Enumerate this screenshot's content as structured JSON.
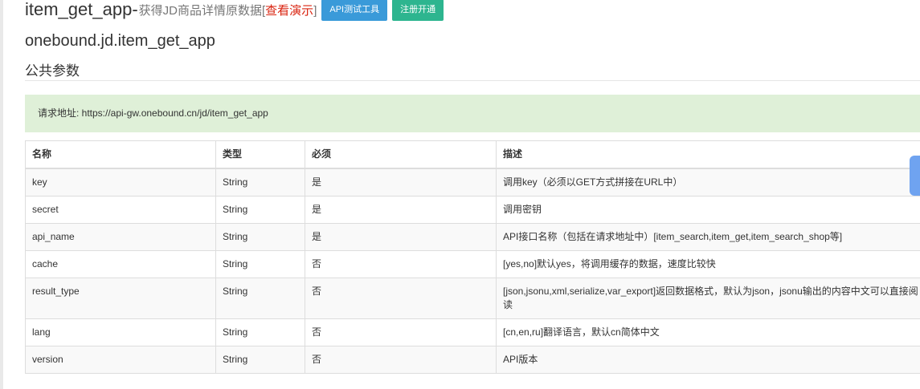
{
  "header": {
    "title": "item_get_app-",
    "subtitle": "获得JD商品详情原数据",
    "demo_open": "[",
    "demo_label": "查看演示",
    "demo_close": "]",
    "btn_api_test": "API测试工具",
    "btn_register": "注册开通"
  },
  "api_name": "onebound.jd.item_get_app",
  "section_title": "公共参数",
  "request_url": "请求地址: https://api-gw.onebound.cn/jd/item_get_app",
  "params_table": {
    "headers": [
      "名称",
      "类型",
      "必须",
      "描述"
    ],
    "rows": [
      {
        "name": "key",
        "type": "String",
        "required": "是",
        "desc": "调用key（必须以GET方式拼接在URL中）"
      },
      {
        "name": "secret",
        "type": "String",
        "required": "是",
        "desc": "调用密钥"
      },
      {
        "name": "api_name",
        "type": "String",
        "required": "是",
        "desc": "API接口名称（包括在请求地址中）[item_search,item_get,item_search_shop等]"
      },
      {
        "name": "cache",
        "type": "String",
        "required": "否",
        "desc": "[yes,no]默认yes，将调用缓存的数据，速度比较快"
      },
      {
        "name": "result_type",
        "type": "String",
        "required": "否",
        "desc": "[json,jsonu,xml,serialize,var_export]返回数据格式，默认为json，jsonu输出的内容中文可以直接阅读"
      },
      {
        "name": "lang",
        "type": "String",
        "required": "否",
        "desc": "[cn,en,ru]翻译语言，默认cn简体中文"
      },
      {
        "name": "version",
        "type": "String",
        "required": "否",
        "desc": "API版本"
      }
    ]
  },
  "colors": {
    "demo_link": "#d9230f",
    "btn_blue": "#3a9ad9",
    "btn_green": "#2db58f",
    "alert_bg": "#dff0d8"
  }
}
